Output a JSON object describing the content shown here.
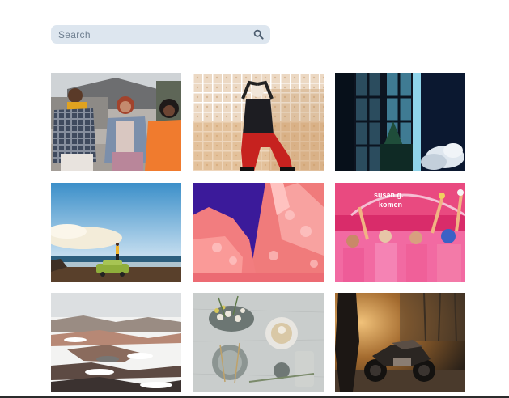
{
  "search": {
    "placeholder": "Search",
    "icon": "search-icon"
  },
  "gallery": {
    "photos": [
      {
        "subject": "friends-sitting-outdoors"
      },
      {
        "subject": "woman-red-pants-posing"
      },
      {
        "subject": "window-with-clouds"
      },
      {
        "subject": "person-on-car-by-sea"
      },
      {
        "subject": "pink-trees-purple-sky"
      },
      {
        "subject": "pink-crowd-celebration"
      },
      {
        "subject": "snowy-landscape"
      },
      {
        "subject": "table-setting-flatlay"
      },
      {
        "subject": "person-with-motorcycle-sunset"
      }
    ]
  },
  "colors": {
    "search_bg": "#dde6ef",
    "search_icon": "#4d5e70"
  }
}
